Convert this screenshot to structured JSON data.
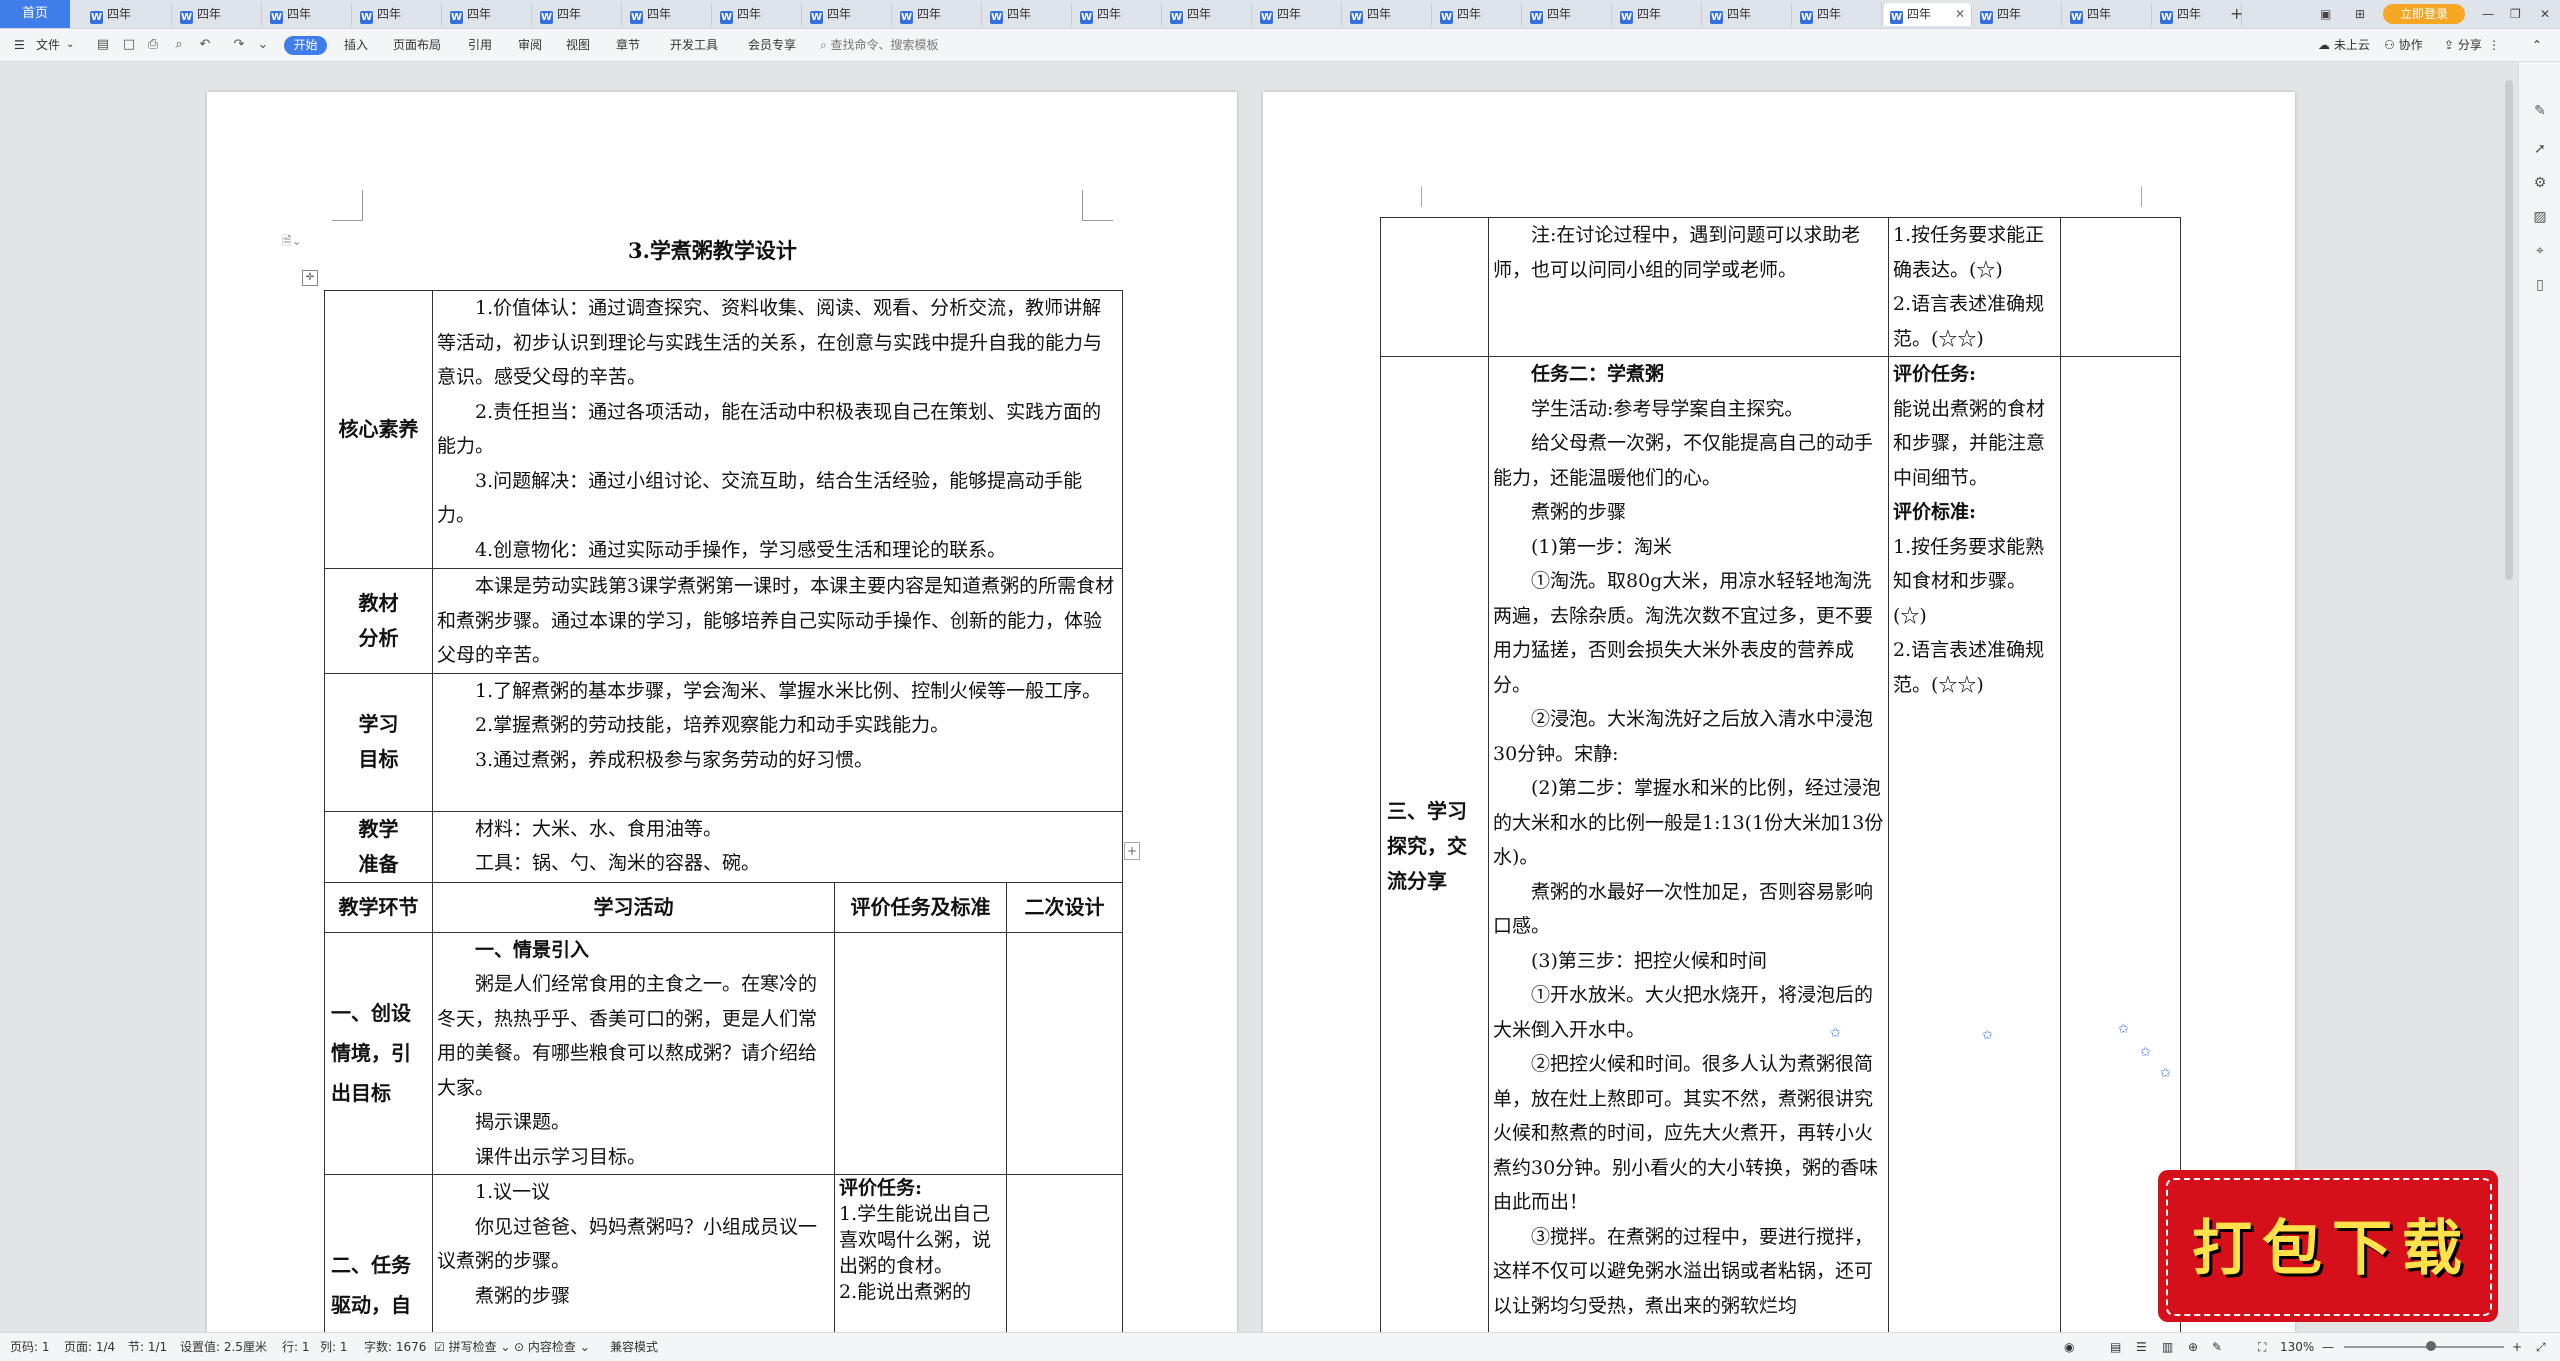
{
  "tabbar": {
    "home": "首页",
    "tabs": [
      "四年",
      "四年",
      "四年",
      "四年",
      "四年",
      "四年",
      "四年",
      "四年",
      "四年",
      "四年",
      "四年",
      "四年",
      "四年",
      "四年",
      "四年",
      "四年",
      "四年",
      "四年",
      "四年",
      "四年",
      "四年",
      "四年",
      "四年",
      "四年"
    ],
    "active_tab": "四年",
    "add": "+",
    "login": "立即登录"
  },
  "toolbar": {
    "file": "文件",
    "menus": [
      "开始",
      "插入",
      "页面布局",
      "引用",
      "审阅",
      "视图",
      "章节",
      "开发工具",
      "会员专享"
    ],
    "search_placeholder": "查找命令、搜索模板",
    "cloud": "未上云",
    "collab": "协作",
    "share": "分享"
  },
  "doc": {
    "title": "3.学煮粥教学设计",
    "core": {
      "label": "核心素养",
      "items": [
        "1.价值体认：通过调查探究、资料收集、阅读、观看、分析交流，教师讲解等活动，初步认识到理论与实践生活的关系，在创意与实践中提升自我的能力与意识。感受父母的辛苦。",
        "2.责任担当：通过各项活动，能在活动中积极表现自己在策划、实践方面的能力。",
        "3.问题解决：通过小组讨论、交流互助，结合生活经验，能够提高动手能力。",
        "4.创意物化：通过实际动手操作，学习感受生活和理论的联系。"
      ]
    },
    "material": {
      "label1": "教材",
      "label2": "分析",
      "text": "本课是劳动实践第3课学煮粥第一课时，本课主要内容是知道煮粥的所需食材和煮粥步骤。通过本课的学习，能够培养自己实际动手操作、创新的能力，体验父母的辛苦。"
    },
    "goals": {
      "label1": "学习",
      "label2": "目标",
      "items": [
        "1.了解煮粥的基本步骤，学会淘米、掌握水米比例、控制火候等一般工序。",
        "2.掌握煮粥的劳动技能，培养观察能力和动手实践能力。",
        "3.通过煮粥，养成积极参与家务劳动的好习惯。"
      ]
    },
    "prep": {
      "label1": "教学",
      "label2": "准备",
      "items": [
        "材料：大米、水、食用油等。",
        "工具：锅、勺、淘米的容器、碗。"
      ]
    },
    "headers": [
      "教学环节",
      "学习活动",
      "评价任务及标准",
      "二次设计"
    ],
    "stage1": {
      "label": "一、创设情境，引出目标",
      "heading": "一、情景引入",
      "paras": [
        "粥是人们经常食用的主食之一。在寒冷的冬天，热热乎乎、香美可口的粥，更是人们常用的美餐。有哪些粮食可以熬成粥？请介绍给大家。",
        "揭示课题。",
        "课件出示学习目标。"
      ]
    },
    "stage2": {
      "label": "二、任务驱动，自",
      "heading": "1.议一议",
      "paras": [
        "你见过爸爸、妈妈煮粥吗？小组成员议一议煮粥的步骤。",
        "煮粥的步骤"
      ],
      "eval_title": "评价任务:",
      "eval_text": "1.学生能说出自己喜欢喝什么粥，说出粥的食材。",
      "eval_text2": "2.能说出煮粥的"
    }
  },
  "page2": {
    "row1": {
      "note": "注:在讨论过程中，遇到问题可以求助老师，也可以问同小组的同学或老师。",
      "eval": [
        "1.按任务要求能正确表达。(☆)",
        "2.语言表述准确规范。(☆☆)"
      ]
    },
    "row2": {
      "label": "三、学习探究，交流分享",
      "task_title": "任务二：学煮粥",
      "paras": [
        "学生活动:参考导学案自主探究。",
        "给父母煮一次粥，不仅能提高自己的动手能力，还能温暖他们的心。",
        "煮粥的步骤",
        "(1)第一步：淘米",
        "①淘洗。取80g大米，用凉水轻轻地淘洗两遍，去除杂质。淘洗次数不宜过多，更不要用力猛搓，否则会损失大米外表皮的营养成分。",
        "②浸泡。大米淘洗好之后放入清水中浸泡30分钟。宋静:",
        "(2)第二步：掌握水和米的比例，经过浸泡的大米和水的比例一般是1:13(1份大米加13份水)。",
        "煮粥的水最好一次性加足，否则容易影响口感。",
        "(3)第三步：把控火候和时间",
        "①开水放米。大火把水烧开，将浸泡后的大米倒入开水中。",
        "②把控火候和时间。很多人认为煮粥很简单，放在灶上熬即可。其实不然，煮粥很讲究火候和熬煮的时间，应先大火煮开，再转小火煮约30分钟。别小看火的大小转换，粥的香味由此而出！",
        "③搅拌。在煮粥的过程中，要进行搅拌，这样不仅可以避免粥水溢出锅或者粘锅，还可以让粥均匀受热，煮出来的粥软烂均"
      ],
      "eval_title": "评价任务:",
      "eval_text": "能说出煮粥的食材和步骤，并能注意中间细节。",
      "std_title": "评价标准:",
      "std": [
        "1.按任务要求能熟知食材和步骤。(☆)",
        "2.语言表述准确规范。(☆☆)"
      ]
    }
  },
  "status": {
    "items": [
      "页码: 1",
      "页面: 1/4",
      "节: 1/1",
      "设置值: 2.5厘米",
      "行: 1",
      "列: 1",
      "字数: 1676",
      "拼写检查",
      "内容检查",
      "兼容模式"
    ],
    "zoom": "130%"
  },
  "banner": {
    "text": "打包下载"
  },
  "colors": {
    "accent": "#3f7de8",
    "banner": "#d5101a",
    "banner_text": "#ffe24a"
  }
}
